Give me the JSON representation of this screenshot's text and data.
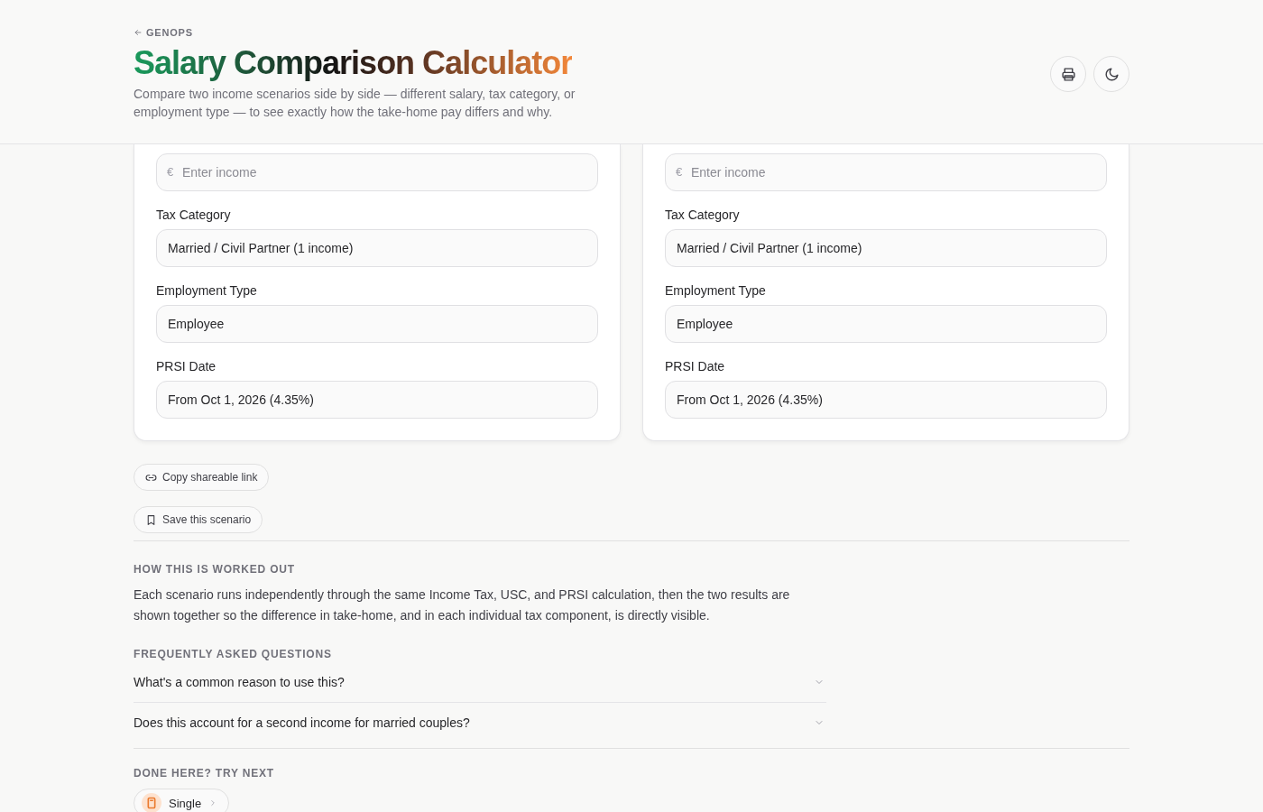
{
  "header": {
    "back_link": "GENOPS",
    "title": "Salary Comparison Calculator",
    "subtitle": "Compare two income scenarios side by side — different salary, tax category, or employment type — to see exactly how the take-home pay differs and why.",
    "buttons": [
      {
        "kind": "print"
      },
      {
        "kind": "theme"
      }
    ]
  },
  "scenarios": [
    {
      "income": {
        "prefix": "€",
        "placeholder": "Enter income"
      },
      "fields": [
        {
          "label": "Tax Category",
          "value": "Married / Civil Partner (1 income)"
        },
        {
          "label": "Employment Type",
          "value": "Employee"
        },
        {
          "label": "PRSI Date",
          "value": "From Oct 1, 2026 (4.35%)"
        }
      ]
    },
    {
      "income": {
        "prefix": "€",
        "placeholder": "Enter income"
      },
      "fields": [
        {
          "label": "Tax Category",
          "value": "Married / Civil Partner (1 income)"
        },
        {
          "label": "Employment Type",
          "value": "Employee"
        },
        {
          "label": "PRSI Date",
          "value": "From Oct 1, 2026 (4.35%)"
        }
      ]
    }
  ],
  "actions": [
    {
      "kind": "link",
      "label": "Copy shareable link"
    },
    {
      "kind": "bookmark",
      "label": "Save this scenario"
    }
  ],
  "method": {
    "heading": "HOW THIS IS WORKED OUT",
    "text": "Each scenario runs independently through the same Income Tax, USC, and PRSI calculation, then the two results are shown together so the difference in take-home, and in each individual tax component, is directly visible."
  },
  "faq": {
    "heading": "FREQUENTLY ASKED QUESTIONS",
    "items": [
      {
        "question": "What's a common reason to use this?",
        "expanded": false
      },
      {
        "question": "Does this account for a second income for married couples?",
        "expanded": false
      }
    ]
  },
  "next": {
    "heading": "DONE HERE? TRY NEXT",
    "items": [
      {
        "label": "Single"
      }
    ]
  }
}
